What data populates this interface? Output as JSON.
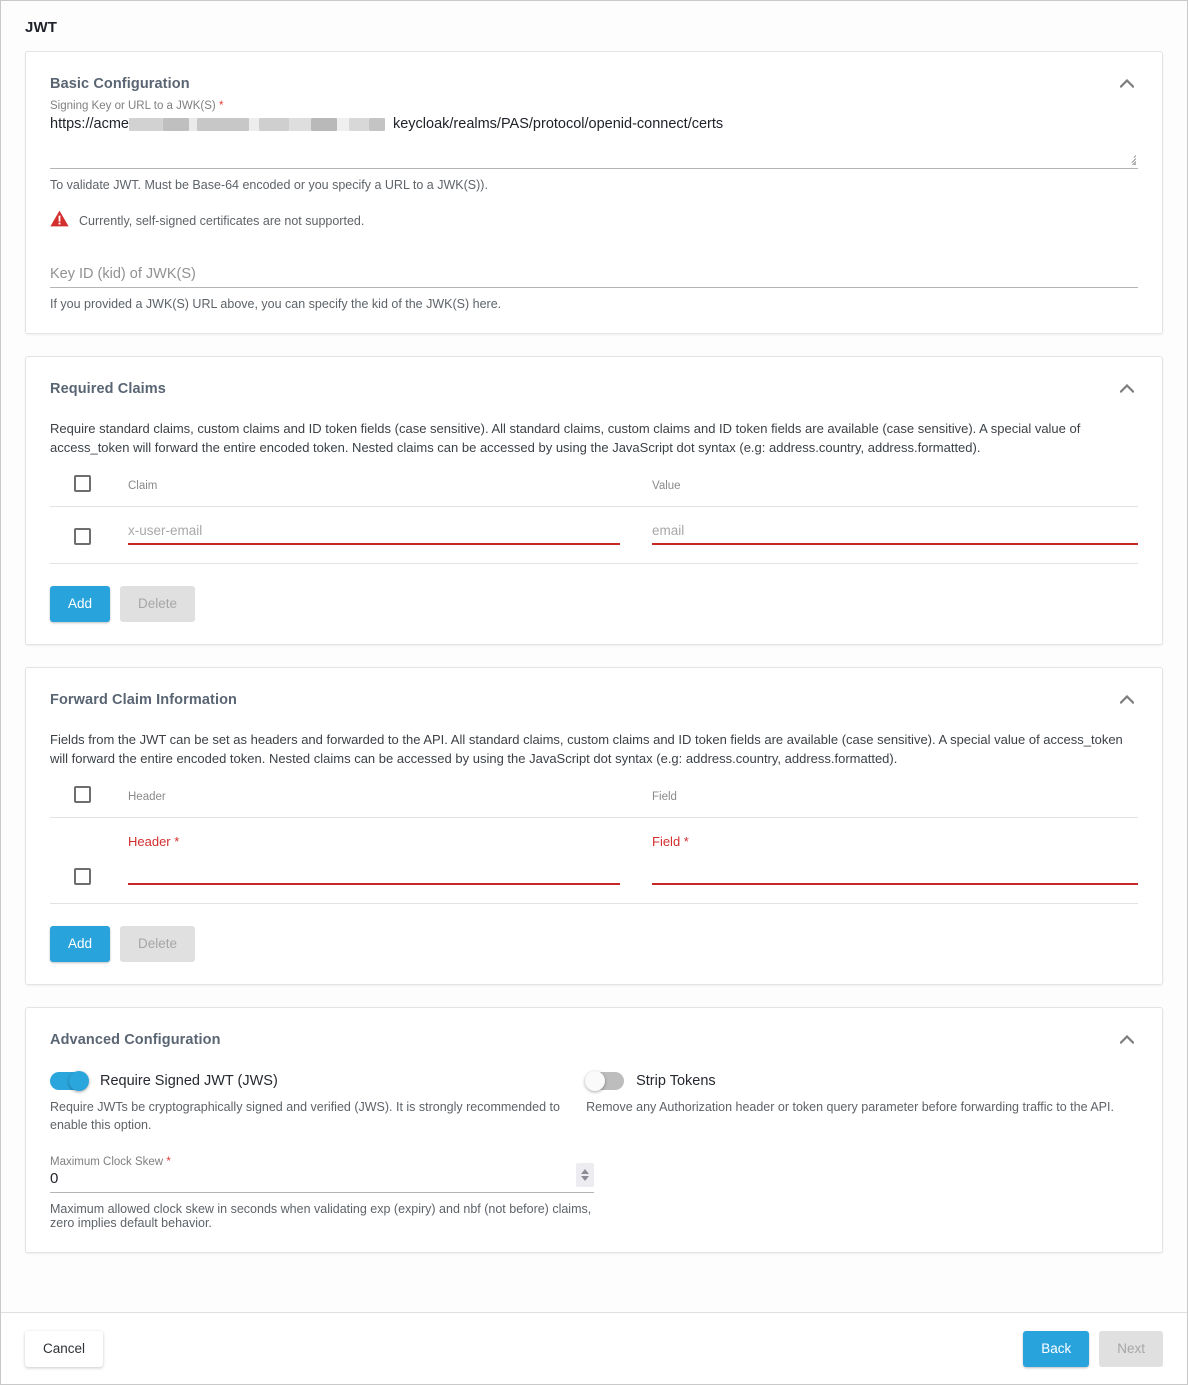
{
  "page": {
    "title": "JWT"
  },
  "basic": {
    "title": "Basic Configuration",
    "signing_key_label": "Signing Key or URL to a JWK(S)",
    "signing_key_required_marker": "*",
    "signing_key_value_prefix": "https://acme",
    "signing_key_value_suffix": "keycloak/realms/PAS/protocol/openid-connect/certs",
    "signing_key_helper": "To validate JWT. Must be Base-64 encoded or you specify a URL to a JWK(S)).",
    "warning_text": "Currently, self-signed certificates are not supported.",
    "kid_placeholder": "Key ID (kid) of JWK(S)",
    "kid_helper": "If you provided a JWK(S) URL above, you can specify the kid of the JWK(S) here."
  },
  "required_claims": {
    "title": "Required Claims",
    "description": "Require standard claims, custom claims and ID token fields (case sensitive). All standard claims, custom claims and ID token fields are available (case sensitive). A special value of access_token will forward the entire encoded token. Nested claims can be accessed by using the JavaScript dot syntax (e.g: address.country, address.formatted).",
    "columns": [
      "Claim",
      "Value"
    ],
    "rows": [
      {
        "claim_placeholder": "x-user-email",
        "value_placeholder": "email"
      }
    ],
    "add_label": "Add",
    "delete_label": "Delete"
  },
  "forward_claims": {
    "title": "Forward Claim Information",
    "description": "Fields from the JWT can be set as headers and forwarded to the API. All standard claims, custom claims and ID token fields are available (case sensitive). A special value of access_token will forward the entire encoded token. Nested claims can be accessed by using the JavaScript dot syntax (e.g: address.country, address.formatted).",
    "columns": [
      "Header",
      "Field"
    ],
    "rows": [
      {
        "header_label": "Header *",
        "field_label": "Field *"
      }
    ],
    "add_label": "Add",
    "delete_label": "Delete"
  },
  "advanced": {
    "title": "Advanced Configuration",
    "require_signed": {
      "label": "Require Signed JWT (JWS)",
      "state": "on",
      "description": "Require JWTs be cryptographically signed and verified (JWS). It is strongly recommended to enable this option."
    },
    "strip_tokens": {
      "label": "Strip Tokens",
      "state": "off",
      "description": "Remove any Authorization header or token query parameter before forwarding traffic to the API."
    },
    "clock_skew": {
      "label": "Maximum Clock Skew",
      "required_marker": "*",
      "value": "0",
      "helper": "Maximum allowed clock skew in seconds when validating exp (expiry) and nbf (not before) claims, zero implies default behavior."
    }
  },
  "footer": {
    "cancel_label": "Cancel",
    "back_label": "Back",
    "next_label": "Next"
  },
  "icons": {
    "collapse": "chevron-up-icon",
    "warning": "warning-triangle-icon",
    "resize": "resize-grip-icon",
    "spinner": "number-spinner-icon"
  },
  "colors": {
    "accent": "#29a3dc",
    "error": "#c62828",
    "warning": "#d32f2f",
    "title": "#5a6573"
  }
}
